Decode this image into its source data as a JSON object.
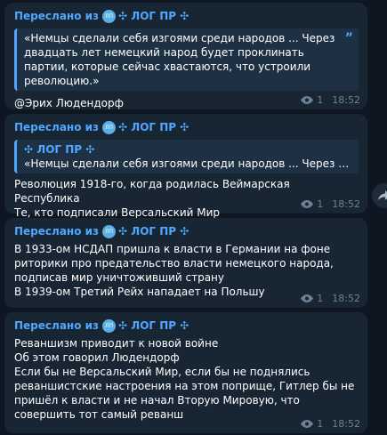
{
  "messages": [
    {
      "forward_label": "Переслано из",
      "avatar_text": "ЛП",
      "channel": "✣ ЛОГ ПР ✣",
      "quote_text": "«Немцы сделали себя изгоями среди народов ... Через двадцать лет немецкий народ будет проклинать партии, которые сейчас хвастаются, что устроили революцию.»",
      "quote_mark": "”",
      "text": "@Эрих Людендорф",
      "views": "1",
      "time": "18:52"
    },
    {
      "forward_label": "Переслано из",
      "avatar_text": "ЛП",
      "channel": "✣ ЛОГ ПР ✣",
      "reply_title": "✣ ЛОГ ПР ✣",
      "reply_text": "«Немцы сделали себя изгоями среди народов ... Через д...",
      "text": "Революция 1918-го, когда родилась Веймарская Республика\nТе, кто подписали Версальский Мир",
      "views": "1",
      "time": "18:52"
    },
    {
      "forward_label": "Переслано из",
      "avatar_text": "ЛП",
      "channel": "✣ ЛОГ ПР ✣",
      "text": "В 1933-ом НСДАП пришла к власти в Германии на фоне риторики про предательство власти немецкого народа, подписав мир уничтоживший страну\nВ 1939-ом Третий Рейх нападает на Польшу",
      "views": "1",
      "time": "18:52"
    },
    {
      "forward_label": "Переслано из",
      "avatar_text": "ЛП",
      "channel": "✣ ЛОГ ПР ✣",
      "text": "Реваншизм приводит к новой войне\nОб этом говорил Людендорф\nЕсли бы не Версальский Мир, если бы не поднялись реваншистские настроения на этом поприще, Гитлер бы не пришёл к власти и не начал Вторую Мировую, что совершить тот самый реванш",
      "views": "1",
      "time": "18:52"
    }
  ],
  "share_icon": "share-icon"
}
